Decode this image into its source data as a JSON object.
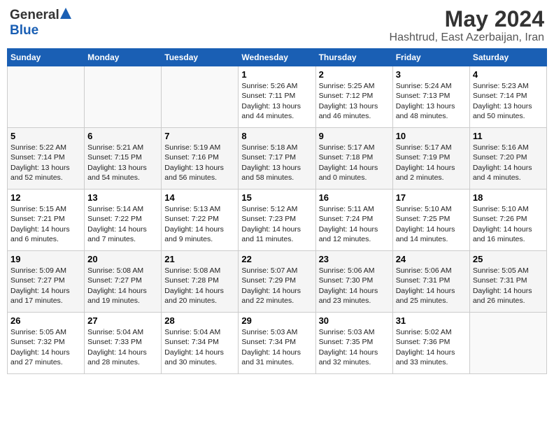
{
  "header": {
    "logo_general": "General",
    "logo_blue": "Blue",
    "month": "May 2024",
    "location": "Hashtrud, East Azerbaijan, Iran"
  },
  "weekdays": [
    "Sunday",
    "Monday",
    "Tuesday",
    "Wednesday",
    "Thursday",
    "Friday",
    "Saturday"
  ],
  "weeks": [
    [
      {
        "day": "",
        "info": ""
      },
      {
        "day": "",
        "info": ""
      },
      {
        "day": "",
        "info": ""
      },
      {
        "day": "1",
        "info": "Sunrise: 5:26 AM\nSunset: 7:11 PM\nDaylight: 13 hours\nand 44 minutes."
      },
      {
        "day": "2",
        "info": "Sunrise: 5:25 AM\nSunset: 7:12 PM\nDaylight: 13 hours\nand 46 minutes."
      },
      {
        "day": "3",
        "info": "Sunrise: 5:24 AM\nSunset: 7:13 PM\nDaylight: 13 hours\nand 48 minutes."
      },
      {
        "day": "4",
        "info": "Sunrise: 5:23 AM\nSunset: 7:14 PM\nDaylight: 13 hours\nand 50 minutes."
      }
    ],
    [
      {
        "day": "5",
        "info": "Sunrise: 5:22 AM\nSunset: 7:14 PM\nDaylight: 13 hours\nand 52 minutes."
      },
      {
        "day": "6",
        "info": "Sunrise: 5:21 AM\nSunset: 7:15 PM\nDaylight: 13 hours\nand 54 minutes."
      },
      {
        "day": "7",
        "info": "Sunrise: 5:19 AM\nSunset: 7:16 PM\nDaylight: 13 hours\nand 56 minutes."
      },
      {
        "day": "8",
        "info": "Sunrise: 5:18 AM\nSunset: 7:17 PM\nDaylight: 13 hours\nand 58 minutes."
      },
      {
        "day": "9",
        "info": "Sunrise: 5:17 AM\nSunset: 7:18 PM\nDaylight: 14 hours\nand 0 minutes."
      },
      {
        "day": "10",
        "info": "Sunrise: 5:17 AM\nSunset: 7:19 PM\nDaylight: 14 hours\nand 2 minutes."
      },
      {
        "day": "11",
        "info": "Sunrise: 5:16 AM\nSunset: 7:20 PM\nDaylight: 14 hours\nand 4 minutes."
      }
    ],
    [
      {
        "day": "12",
        "info": "Sunrise: 5:15 AM\nSunset: 7:21 PM\nDaylight: 14 hours\nand 6 minutes."
      },
      {
        "day": "13",
        "info": "Sunrise: 5:14 AM\nSunset: 7:22 PM\nDaylight: 14 hours\nand 7 minutes."
      },
      {
        "day": "14",
        "info": "Sunrise: 5:13 AM\nSunset: 7:22 PM\nDaylight: 14 hours\nand 9 minutes."
      },
      {
        "day": "15",
        "info": "Sunrise: 5:12 AM\nSunset: 7:23 PM\nDaylight: 14 hours\nand 11 minutes."
      },
      {
        "day": "16",
        "info": "Sunrise: 5:11 AM\nSunset: 7:24 PM\nDaylight: 14 hours\nand 12 minutes."
      },
      {
        "day": "17",
        "info": "Sunrise: 5:10 AM\nSunset: 7:25 PM\nDaylight: 14 hours\nand 14 minutes."
      },
      {
        "day": "18",
        "info": "Sunrise: 5:10 AM\nSunset: 7:26 PM\nDaylight: 14 hours\nand 16 minutes."
      }
    ],
    [
      {
        "day": "19",
        "info": "Sunrise: 5:09 AM\nSunset: 7:27 PM\nDaylight: 14 hours\nand 17 minutes."
      },
      {
        "day": "20",
        "info": "Sunrise: 5:08 AM\nSunset: 7:27 PM\nDaylight: 14 hours\nand 19 minutes."
      },
      {
        "day": "21",
        "info": "Sunrise: 5:08 AM\nSunset: 7:28 PM\nDaylight: 14 hours\nand 20 minutes."
      },
      {
        "day": "22",
        "info": "Sunrise: 5:07 AM\nSunset: 7:29 PM\nDaylight: 14 hours\nand 22 minutes."
      },
      {
        "day": "23",
        "info": "Sunrise: 5:06 AM\nSunset: 7:30 PM\nDaylight: 14 hours\nand 23 minutes."
      },
      {
        "day": "24",
        "info": "Sunrise: 5:06 AM\nSunset: 7:31 PM\nDaylight: 14 hours\nand 25 minutes."
      },
      {
        "day": "25",
        "info": "Sunrise: 5:05 AM\nSunset: 7:31 PM\nDaylight: 14 hours\nand 26 minutes."
      }
    ],
    [
      {
        "day": "26",
        "info": "Sunrise: 5:05 AM\nSunset: 7:32 PM\nDaylight: 14 hours\nand 27 minutes."
      },
      {
        "day": "27",
        "info": "Sunrise: 5:04 AM\nSunset: 7:33 PM\nDaylight: 14 hours\nand 28 minutes."
      },
      {
        "day": "28",
        "info": "Sunrise: 5:04 AM\nSunset: 7:34 PM\nDaylight: 14 hours\nand 30 minutes."
      },
      {
        "day": "29",
        "info": "Sunrise: 5:03 AM\nSunset: 7:34 PM\nDaylight: 14 hours\nand 31 minutes."
      },
      {
        "day": "30",
        "info": "Sunrise: 5:03 AM\nSunset: 7:35 PM\nDaylight: 14 hours\nand 32 minutes."
      },
      {
        "day": "31",
        "info": "Sunrise: 5:02 AM\nSunset: 7:36 PM\nDaylight: 14 hours\nand 33 minutes."
      },
      {
        "day": "",
        "info": ""
      }
    ]
  ]
}
